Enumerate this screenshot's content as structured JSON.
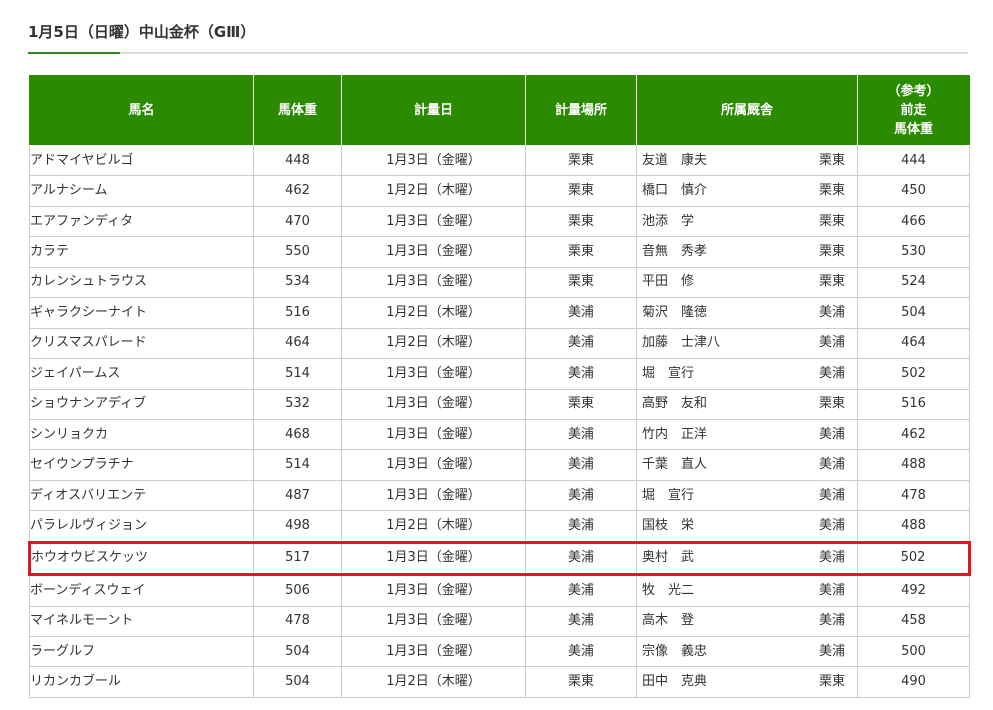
{
  "race": {
    "title": "1月5日（日曜）中山金杯（GⅢ）"
  },
  "table": {
    "headers": {
      "horse_name": "馬名",
      "weight": "馬体重",
      "date": "計量日",
      "place": "計量場所",
      "stable": "所属厩舎",
      "prev_line1": "（参考）",
      "prev_line2": "前走",
      "prev_line3": "馬体重"
    },
    "highlight_color": "#e3161f",
    "header_color": "#2a8a00",
    "rows": [
      {
        "name": "アドマイヤビルゴ",
        "weight": "448",
        "date": "1月3日（金曜）",
        "place": "栗東",
        "trainer": "友道　康夫",
        "loc": "栗東",
        "prev": "444",
        "highlighted": false
      },
      {
        "name": "アルナシーム",
        "weight": "462",
        "date": "1月2日（木曜）",
        "place": "栗東",
        "trainer": "橋口　慎介",
        "loc": "栗東",
        "prev": "450",
        "highlighted": false
      },
      {
        "name": "エアファンディタ",
        "weight": "470",
        "date": "1月3日（金曜）",
        "place": "栗東",
        "trainer": "池添　学",
        "loc": "栗東",
        "prev": "466",
        "highlighted": false
      },
      {
        "name": "カラテ",
        "weight": "550",
        "date": "1月3日（金曜）",
        "place": "栗東",
        "trainer": "音無　秀孝",
        "loc": "栗東",
        "prev": "530",
        "highlighted": false
      },
      {
        "name": "カレンシュトラウス",
        "weight": "534",
        "date": "1月3日（金曜）",
        "place": "栗東",
        "trainer": "平田　修",
        "loc": "栗東",
        "prev": "524",
        "highlighted": false
      },
      {
        "name": "ギャラクシーナイト",
        "weight": "516",
        "date": "1月2日（木曜）",
        "place": "美浦",
        "trainer": "菊沢　隆徳",
        "loc": "美浦",
        "prev": "504",
        "highlighted": false
      },
      {
        "name": "クリスマスパレード",
        "weight": "464",
        "date": "1月2日（木曜）",
        "place": "美浦",
        "trainer": "加藤　士津八",
        "loc": "美浦",
        "prev": "464",
        "highlighted": false
      },
      {
        "name": "ジェイパームス",
        "weight": "514",
        "date": "1月3日（金曜）",
        "place": "美浦",
        "trainer": "堀　宣行",
        "loc": "美浦",
        "prev": "502",
        "highlighted": false
      },
      {
        "name": "ショウナンアディブ",
        "weight": "532",
        "date": "1月3日（金曜）",
        "place": "栗東",
        "trainer": "高野　友和",
        "loc": "栗東",
        "prev": "516",
        "highlighted": false
      },
      {
        "name": "シンリョクカ",
        "weight": "468",
        "date": "1月3日（金曜）",
        "place": "美浦",
        "trainer": "竹内　正洋",
        "loc": "美浦",
        "prev": "462",
        "highlighted": false
      },
      {
        "name": "セイウンプラチナ",
        "weight": "514",
        "date": "1月3日（金曜）",
        "place": "美浦",
        "trainer": "千葉　直人",
        "loc": "美浦",
        "prev": "488",
        "highlighted": false
      },
      {
        "name": "ディオスバリエンテ",
        "weight": "487",
        "date": "1月3日（金曜）",
        "place": "美浦",
        "trainer": "堀　宣行",
        "loc": "美浦",
        "prev": "478",
        "highlighted": false
      },
      {
        "name": "パラレルヴィジョン",
        "weight": "498",
        "date": "1月2日（木曜）",
        "place": "美浦",
        "trainer": "国枝　栄",
        "loc": "美浦",
        "prev": "488",
        "highlighted": false
      },
      {
        "name": "ホウオウビスケッツ",
        "weight": "517",
        "date": "1月3日（金曜）",
        "place": "美浦",
        "trainer": "奥村　武",
        "loc": "美浦",
        "prev": "502",
        "highlighted": true
      },
      {
        "name": "ボーンディスウェイ",
        "weight": "506",
        "date": "1月3日（金曜）",
        "place": "美浦",
        "trainer": "牧　光二",
        "loc": "美浦",
        "prev": "492",
        "highlighted": false
      },
      {
        "name": "マイネルモーント",
        "weight": "478",
        "date": "1月3日（金曜）",
        "place": "美浦",
        "trainer": "高木　登",
        "loc": "美浦",
        "prev": "458",
        "highlighted": false
      },
      {
        "name": "ラーグルフ",
        "weight": "504",
        "date": "1月3日（金曜）",
        "place": "美浦",
        "trainer": "宗像　義忠",
        "loc": "美浦",
        "prev": "500",
        "highlighted": false
      },
      {
        "name": "リカンカブール",
        "weight": "504",
        "date": "1月2日（木曜）",
        "place": "栗東",
        "trainer": "田中　克典",
        "loc": "栗東",
        "prev": "490",
        "highlighted": false
      }
    ]
  }
}
